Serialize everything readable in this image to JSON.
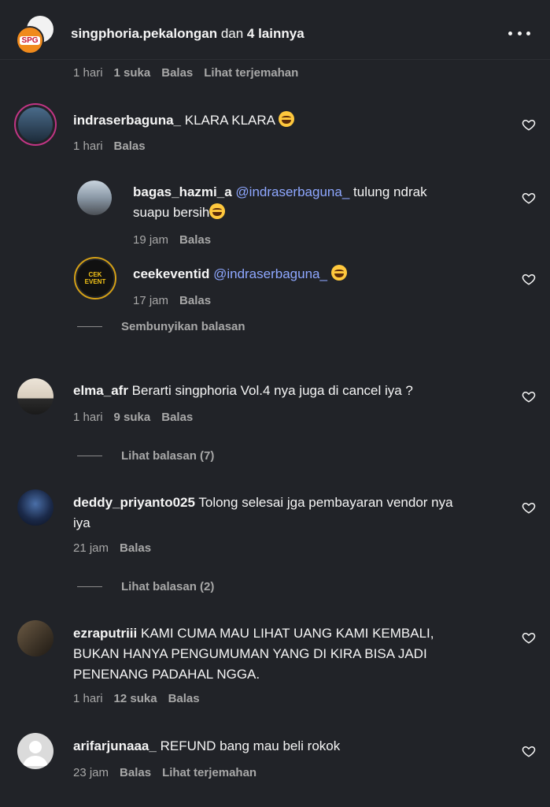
{
  "header": {
    "account": "singphoria.pekalongan",
    "and_text": " dan ",
    "others": "4 lainnya",
    "logo_text": "SPG"
  },
  "top_meta": {
    "time": "1 hari",
    "likes": "1 suka",
    "reply": "Balas",
    "translate": "Lihat terjemahan"
  },
  "comments": [
    {
      "user": "indraserbaguna_",
      "text": "KLARA KLARA",
      "time": "1 hari",
      "reply": "Balas"
    },
    {
      "user": "bagas_hazmi_a",
      "mention": "@indraserbaguna_",
      "text_line1": "tulung ndrak",
      "text_line2": "suapu bersih",
      "time": "19 jam",
      "reply": "Balas"
    },
    {
      "user": "ceekeventid",
      "mention": "@indraserbaguna_",
      "time": "17 jam",
      "reply": "Balas",
      "avatar_text": "CEK EVENT"
    },
    {
      "user": "elma_afr",
      "text": "Berarti singphoria Vol.4 nya juga di cancel iya ?",
      "time": "1 hari",
      "likes": "9 suka",
      "reply": "Balas"
    },
    {
      "user": "deddy_priyanto025",
      "text_line1": "Tolong selesai jga pembayaran vendor nya",
      "text_line2": "iya",
      "time": "21 jam",
      "reply": "Balas"
    },
    {
      "user": "ezraputriii",
      "text_line1": "KAMI CUMA MAU LIHAT UANG KAMI KEMBALI,",
      "text_line2": "BUKAN HANYA PENGUMUMAN YANG DI KIRA BISA JADI",
      "text_line3": "PENENANG PADAHAL NGGA.",
      "time": "1 hari",
      "likes": "12 suka",
      "reply": "Balas"
    },
    {
      "user": "arifarjunaaa_",
      "text": "REFUND bang mau beli rokok",
      "time": "23 jam",
      "reply": "Balas",
      "translate": "Lihat terjemahan"
    }
  ],
  "toggles": {
    "hide_replies": "Sembunyikan balasan",
    "view_replies_7": "Lihat balasan (7)",
    "view_replies_2": "Lihat balasan (2)"
  },
  "colors": {
    "background": "#212328",
    "text": "#f5f5f5",
    "muted": "#a8a8a8",
    "mention": "#8ea7ff"
  }
}
